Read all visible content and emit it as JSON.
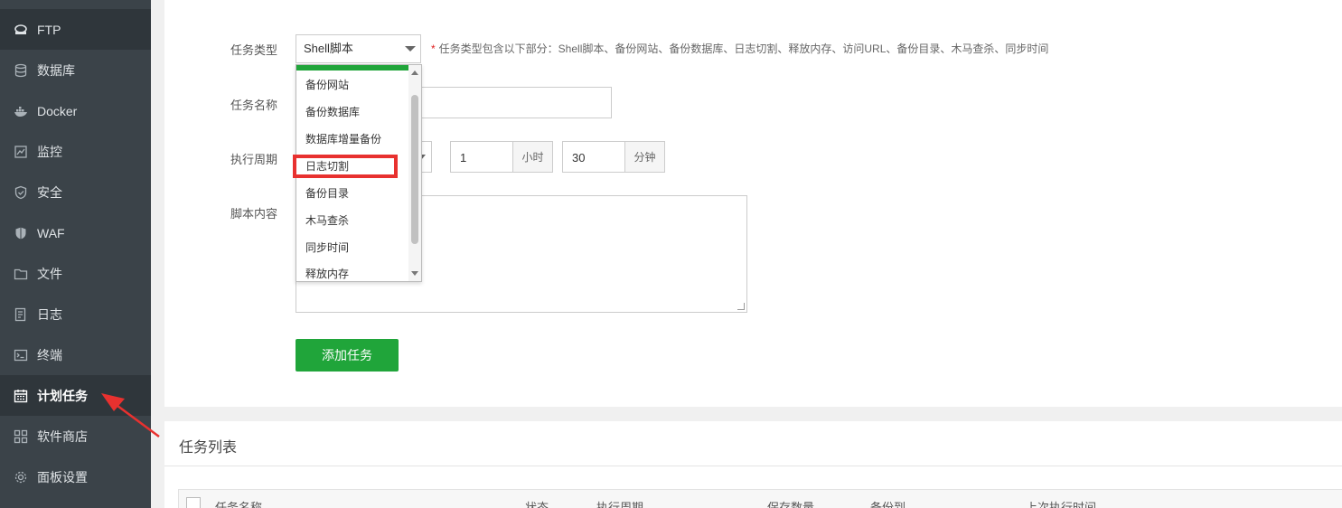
{
  "sidebar": {
    "items": [
      {
        "label": "FTP",
        "icon": "ftp-icon"
      },
      {
        "label": "数据库",
        "icon": "database-icon"
      },
      {
        "label": "Docker",
        "icon": "docker-icon"
      },
      {
        "label": "监控",
        "icon": "monitor-icon"
      },
      {
        "label": "安全",
        "icon": "shield-icon"
      },
      {
        "label": "WAF",
        "icon": "waf-icon"
      },
      {
        "label": "文件",
        "icon": "folder-icon"
      },
      {
        "label": "日志",
        "icon": "log-icon"
      },
      {
        "label": "终端",
        "icon": "terminal-icon"
      },
      {
        "label": "计划任务",
        "icon": "calendar-icon"
      },
      {
        "label": "软件商店",
        "icon": "grid-icon"
      },
      {
        "label": "面板设置",
        "icon": "gear-icon"
      }
    ],
    "active_index": 9
  },
  "form": {
    "task_type_label": "任务类型",
    "task_type_value": "Shell脚本",
    "hint_star": "*",
    "hint_text": "任务类型包含以下部分：Shell脚本、备份网站、备份数据库、日志切割、释放内存、访问URL、备份目录、木马查杀、同步时间",
    "task_name_label": "任务名称",
    "period_label": "执行周期",
    "hour_value": "1",
    "hour_unit": "小时",
    "minute_value": "30",
    "minute_unit": "分钟",
    "script_label": "脚本内容",
    "add_button": "添加任务"
  },
  "dropdown": {
    "options": [
      "备份网站",
      "备份数据库",
      "数据库增量备份",
      "日志切割",
      "备份目录",
      "木马查杀",
      "同步时间",
      "释放内存"
    ],
    "highlighted": "日志切割"
  },
  "task_list": {
    "title": "任务列表",
    "columns": [
      "任务名称",
      "状态",
      "执行周期",
      "保存数量",
      "备份到",
      "上次执行时间"
    ]
  },
  "colors": {
    "accent": "#20a53a",
    "highlight": "#e8312f",
    "sidebar": "#3b4349"
  }
}
